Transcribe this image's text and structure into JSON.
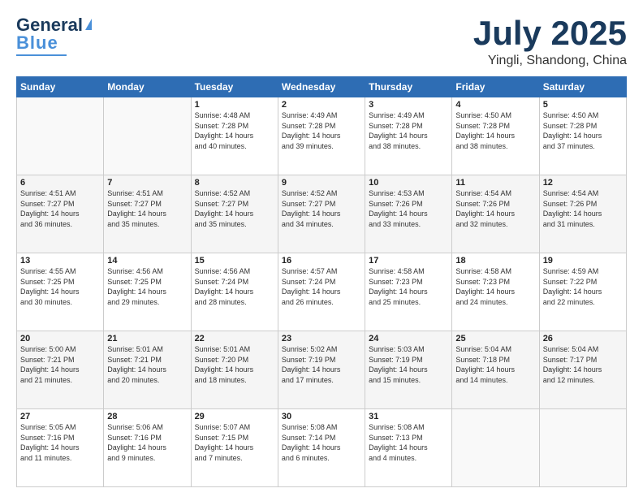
{
  "header": {
    "logo_line1": "General",
    "logo_line2": "Blue",
    "month": "July 2025",
    "location": "Yingli, Shandong, China"
  },
  "weekdays": [
    "Sunday",
    "Monday",
    "Tuesday",
    "Wednesday",
    "Thursday",
    "Friday",
    "Saturday"
  ],
  "weeks": [
    [
      {
        "day": "",
        "info": ""
      },
      {
        "day": "",
        "info": ""
      },
      {
        "day": "1",
        "info": "Sunrise: 4:48 AM\nSunset: 7:28 PM\nDaylight: 14 hours\nand 40 minutes."
      },
      {
        "day": "2",
        "info": "Sunrise: 4:49 AM\nSunset: 7:28 PM\nDaylight: 14 hours\nand 39 minutes."
      },
      {
        "day": "3",
        "info": "Sunrise: 4:49 AM\nSunset: 7:28 PM\nDaylight: 14 hours\nand 38 minutes."
      },
      {
        "day": "4",
        "info": "Sunrise: 4:50 AM\nSunset: 7:28 PM\nDaylight: 14 hours\nand 38 minutes."
      },
      {
        "day": "5",
        "info": "Sunrise: 4:50 AM\nSunset: 7:28 PM\nDaylight: 14 hours\nand 37 minutes."
      }
    ],
    [
      {
        "day": "6",
        "info": "Sunrise: 4:51 AM\nSunset: 7:27 PM\nDaylight: 14 hours\nand 36 minutes."
      },
      {
        "day": "7",
        "info": "Sunrise: 4:51 AM\nSunset: 7:27 PM\nDaylight: 14 hours\nand 35 minutes."
      },
      {
        "day": "8",
        "info": "Sunrise: 4:52 AM\nSunset: 7:27 PM\nDaylight: 14 hours\nand 35 minutes."
      },
      {
        "day": "9",
        "info": "Sunrise: 4:52 AM\nSunset: 7:27 PM\nDaylight: 14 hours\nand 34 minutes."
      },
      {
        "day": "10",
        "info": "Sunrise: 4:53 AM\nSunset: 7:26 PM\nDaylight: 14 hours\nand 33 minutes."
      },
      {
        "day": "11",
        "info": "Sunrise: 4:54 AM\nSunset: 7:26 PM\nDaylight: 14 hours\nand 32 minutes."
      },
      {
        "day": "12",
        "info": "Sunrise: 4:54 AM\nSunset: 7:26 PM\nDaylight: 14 hours\nand 31 minutes."
      }
    ],
    [
      {
        "day": "13",
        "info": "Sunrise: 4:55 AM\nSunset: 7:25 PM\nDaylight: 14 hours\nand 30 minutes."
      },
      {
        "day": "14",
        "info": "Sunrise: 4:56 AM\nSunset: 7:25 PM\nDaylight: 14 hours\nand 29 minutes."
      },
      {
        "day": "15",
        "info": "Sunrise: 4:56 AM\nSunset: 7:24 PM\nDaylight: 14 hours\nand 28 minutes."
      },
      {
        "day": "16",
        "info": "Sunrise: 4:57 AM\nSunset: 7:24 PM\nDaylight: 14 hours\nand 26 minutes."
      },
      {
        "day": "17",
        "info": "Sunrise: 4:58 AM\nSunset: 7:23 PM\nDaylight: 14 hours\nand 25 minutes."
      },
      {
        "day": "18",
        "info": "Sunrise: 4:58 AM\nSunset: 7:23 PM\nDaylight: 14 hours\nand 24 minutes."
      },
      {
        "day": "19",
        "info": "Sunrise: 4:59 AM\nSunset: 7:22 PM\nDaylight: 14 hours\nand 22 minutes."
      }
    ],
    [
      {
        "day": "20",
        "info": "Sunrise: 5:00 AM\nSunset: 7:21 PM\nDaylight: 14 hours\nand 21 minutes."
      },
      {
        "day": "21",
        "info": "Sunrise: 5:01 AM\nSunset: 7:21 PM\nDaylight: 14 hours\nand 20 minutes."
      },
      {
        "day": "22",
        "info": "Sunrise: 5:01 AM\nSunset: 7:20 PM\nDaylight: 14 hours\nand 18 minutes."
      },
      {
        "day": "23",
        "info": "Sunrise: 5:02 AM\nSunset: 7:19 PM\nDaylight: 14 hours\nand 17 minutes."
      },
      {
        "day": "24",
        "info": "Sunrise: 5:03 AM\nSunset: 7:19 PM\nDaylight: 14 hours\nand 15 minutes."
      },
      {
        "day": "25",
        "info": "Sunrise: 5:04 AM\nSunset: 7:18 PM\nDaylight: 14 hours\nand 14 minutes."
      },
      {
        "day": "26",
        "info": "Sunrise: 5:04 AM\nSunset: 7:17 PM\nDaylight: 14 hours\nand 12 minutes."
      }
    ],
    [
      {
        "day": "27",
        "info": "Sunrise: 5:05 AM\nSunset: 7:16 PM\nDaylight: 14 hours\nand 11 minutes."
      },
      {
        "day": "28",
        "info": "Sunrise: 5:06 AM\nSunset: 7:16 PM\nDaylight: 14 hours\nand 9 minutes."
      },
      {
        "day": "29",
        "info": "Sunrise: 5:07 AM\nSunset: 7:15 PM\nDaylight: 14 hours\nand 7 minutes."
      },
      {
        "day": "30",
        "info": "Sunrise: 5:08 AM\nSunset: 7:14 PM\nDaylight: 14 hours\nand 6 minutes."
      },
      {
        "day": "31",
        "info": "Sunrise: 5:08 AM\nSunset: 7:13 PM\nDaylight: 14 hours\nand 4 minutes."
      },
      {
        "day": "",
        "info": ""
      },
      {
        "day": "",
        "info": ""
      }
    ]
  ]
}
